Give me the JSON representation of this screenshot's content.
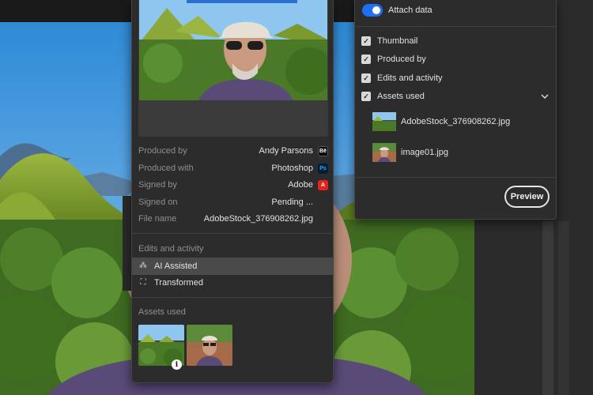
{
  "content_credentials": {
    "metadata": [
      {
        "key": "Produced by",
        "value": "Andy Parsons",
        "badge": "Bē",
        "badge_type": "be"
      },
      {
        "key": "Produced with",
        "value": "Photoshop",
        "badge": "Ps",
        "badge_type": "ps"
      },
      {
        "key": "Signed by",
        "value": "Adobe",
        "badge": "A",
        "badge_type": "adobe"
      },
      {
        "key": "Signed on",
        "value": "Pending ...",
        "badge": "",
        "badge_type": "empty"
      },
      {
        "key": "File name",
        "value": "AdobeStock_376908262.jpg",
        "badge": "",
        "badge_type": "empty"
      }
    ],
    "edits_title": "Edits and activity",
    "edits": [
      {
        "label": "AI Assisted",
        "icon": "ai-assisted-icon",
        "glyph": "⁂"
      },
      {
        "label": "Transformed",
        "icon": "transform-icon",
        "glyph": "⛶"
      }
    ],
    "assets_title": "Assets used",
    "info_glyph": "i"
  },
  "export_options": {
    "attach_data_label": "Attach data",
    "checkboxes": [
      {
        "label": "Thumbnail",
        "checked": true
      },
      {
        "label": "Produced by",
        "checked": true
      },
      {
        "label": "Edits and activity",
        "checked": true
      },
      {
        "label": "Assets used",
        "checked": true
      }
    ],
    "assets": [
      {
        "name": "AdobeStock_376908262.jpg",
        "thumb": "landscape"
      },
      {
        "name": "image01.jpg",
        "thumb": "portrait"
      }
    ],
    "preview_label": "Preview",
    "check_glyph": "✓"
  },
  "colors": {
    "accent": "#1f6ff2",
    "panel_bg": "#2c2c2c",
    "sky": "#3d9be0",
    "hill_green": "#7a9a2e"
  }
}
